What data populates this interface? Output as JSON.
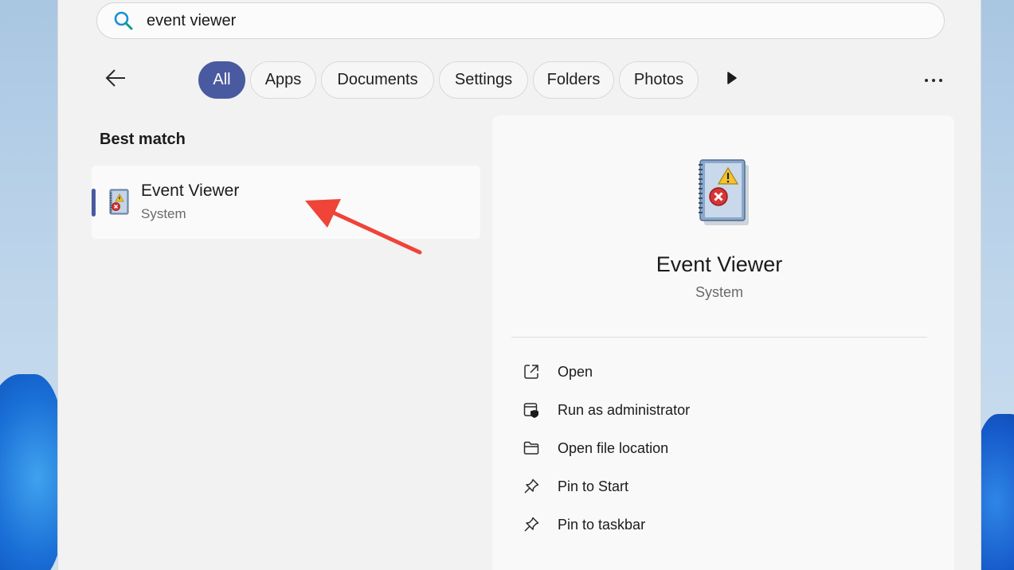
{
  "search": {
    "value": "event viewer",
    "icon": "search-icon"
  },
  "filters": {
    "items": [
      {
        "label": "All",
        "active": true
      },
      {
        "label": "Apps",
        "active": false
      },
      {
        "label": "Documents",
        "active": false
      },
      {
        "label": "Settings",
        "active": false
      },
      {
        "label": "Folders",
        "active": false
      },
      {
        "label": "Photos",
        "active": false
      }
    ]
  },
  "best_match": {
    "heading": "Best match",
    "title": "Event Viewer",
    "subtitle": "System"
  },
  "details": {
    "title": "Event Viewer",
    "subtitle": "System",
    "actions": [
      {
        "label": "Open",
        "icon": "open-external-icon"
      },
      {
        "label": "Run as administrator",
        "icon": "shield-admin-icon"
      },
      {
        "label": "Open file location",
        "icon": "folder-icon"
      },
      {
        "label": "Pin to Start",
        "icon": "pin-icon"
      },
      {
        "label": "Pin to taskbar",
        "icon": "pin-icon"
      }
    ]
  },
  "colors": {
    "accent": "#4a5aa0",
    "annotation_arrow": "#ef4437"
  }
}
